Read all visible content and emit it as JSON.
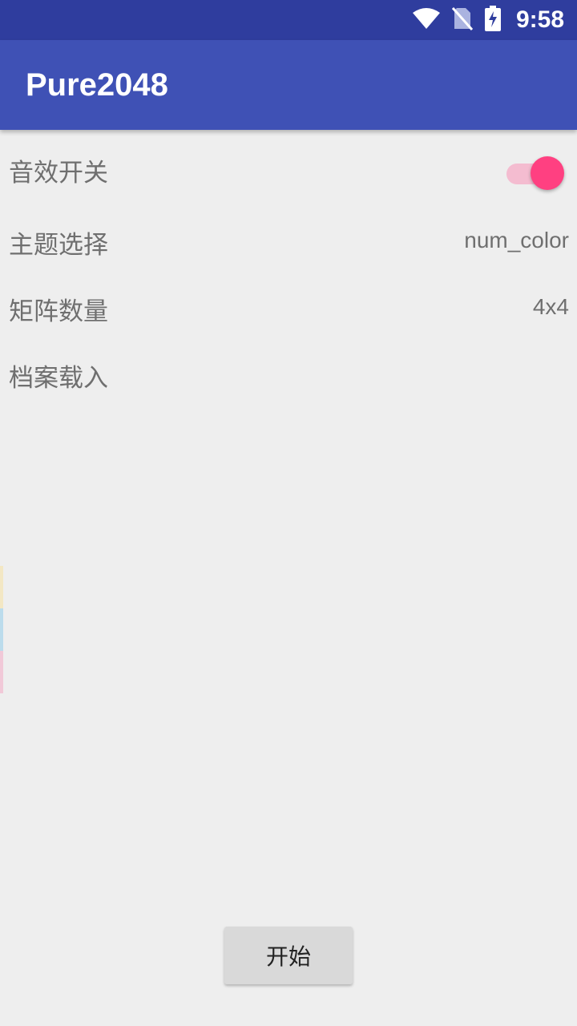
{
  "status_bar": {
    "time": "9:58",
    "icons": [
      "wifi-icon",
      "no-sim-icon",
      "battery-charging-icon"
    ]
  },
  "app_bar": {
    "title": "Pure2048"
  },
  "settings": {
    "sound": {
      "label": "音效开关",
      "enabled": true
    },
    "theme": {
      "label": "主题选择",
      "value": "num_color"
    },
    "matrix": {
      "label": "矩阵数量",
      "value": "4x4"
    },
    "load": {
      "label": "档案载入"
    }
  },
  "start_button": {
    "label": "开始"
  },
  "colors": {
    "status_bar": "#2f3d9e",
    "app_bar": "#3f51b5",
    "background": "#eeeeee",
    "accent": "#ff4081",
    "edge_strip": [
      "#f3e7c4",
      "#bcdcec",
      "#f1c9d8"
    ]
  }
}
